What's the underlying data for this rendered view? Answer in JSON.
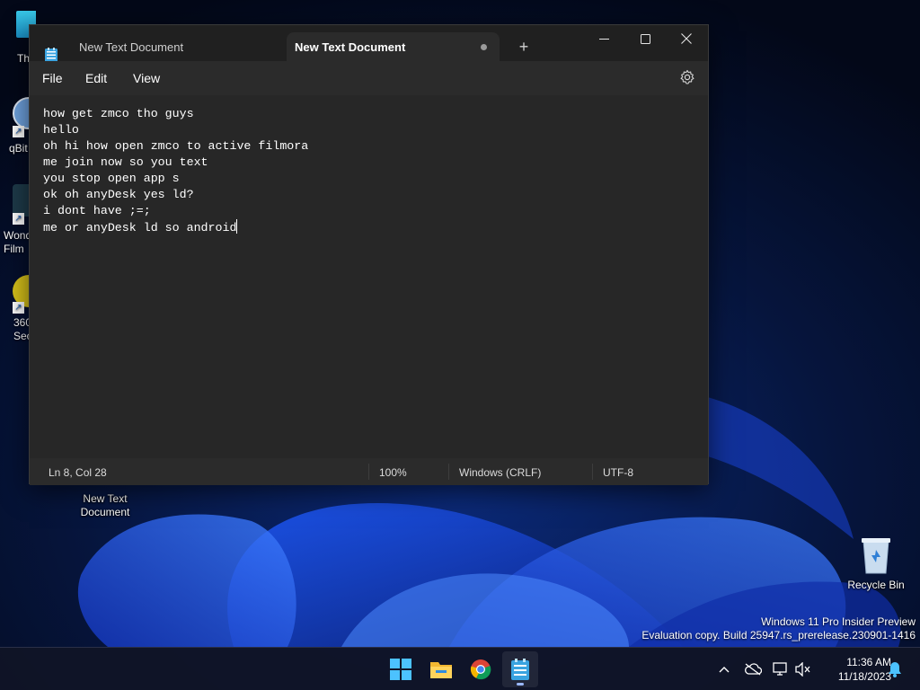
{
  "desktop": {
    "left_icons": [
      {
        "label": "Th"
      },
      {
        "label": "qBit"
      },
      {
        "label": "Wond\nFilm"
      },
      {
        "label": "360\nSec"
      }
    ],
    "new_text_document": {
      "label": "New Text\nDocument"
    },
    "recycle_bin": {
      "label": "Recycle Bin"
    }
  },
  "window": {
    "tabs": [
      {
        "label": "New Text Document",
        "active": false
      },
      {
        "label": "New Text Document",
        "active": true
      }
    ],
    "new_tab_label": "+",
    "menu": [
      "File",
      "Edit",
      "View"
    ],
    "editor_lines": [
      "how get zmco tho guys",
      "hello",
      "oh hi how open zmco to active filmora",
      "me join now so you text",
      "you stop open app s",
      "ok oh anyDesk yes ld?",
      "i dont have ;=;",
      "me or anyDesk ld so android"
    ],
    "status": {
      "position": "Ln 8, Col 28",
      "zoom": "100%",
      "line_ending": "Windows (CRLF)",
      "encoding": "UTF-8"
    }
  },
  "watermark": {
    "line1": "Windows 11 Pro Insider Preview",
    "line2": "Evaluation copy. Build 25947.rs_prerelease.230901-1416"
  },
  "taskbar": {
    "apps": [
      "windows-start-icon",
      "file-explorer-icon",
      "chrome-icon",
      "notepad-icon"
    ],
    "time": "11:36 AM",
    "date": "11/18/2023"
  },
  "colors": {
    "window_bg": "#202020",
    "editor_bg": "#272727",
    "accent": "#4cc2ff"
  }
}
